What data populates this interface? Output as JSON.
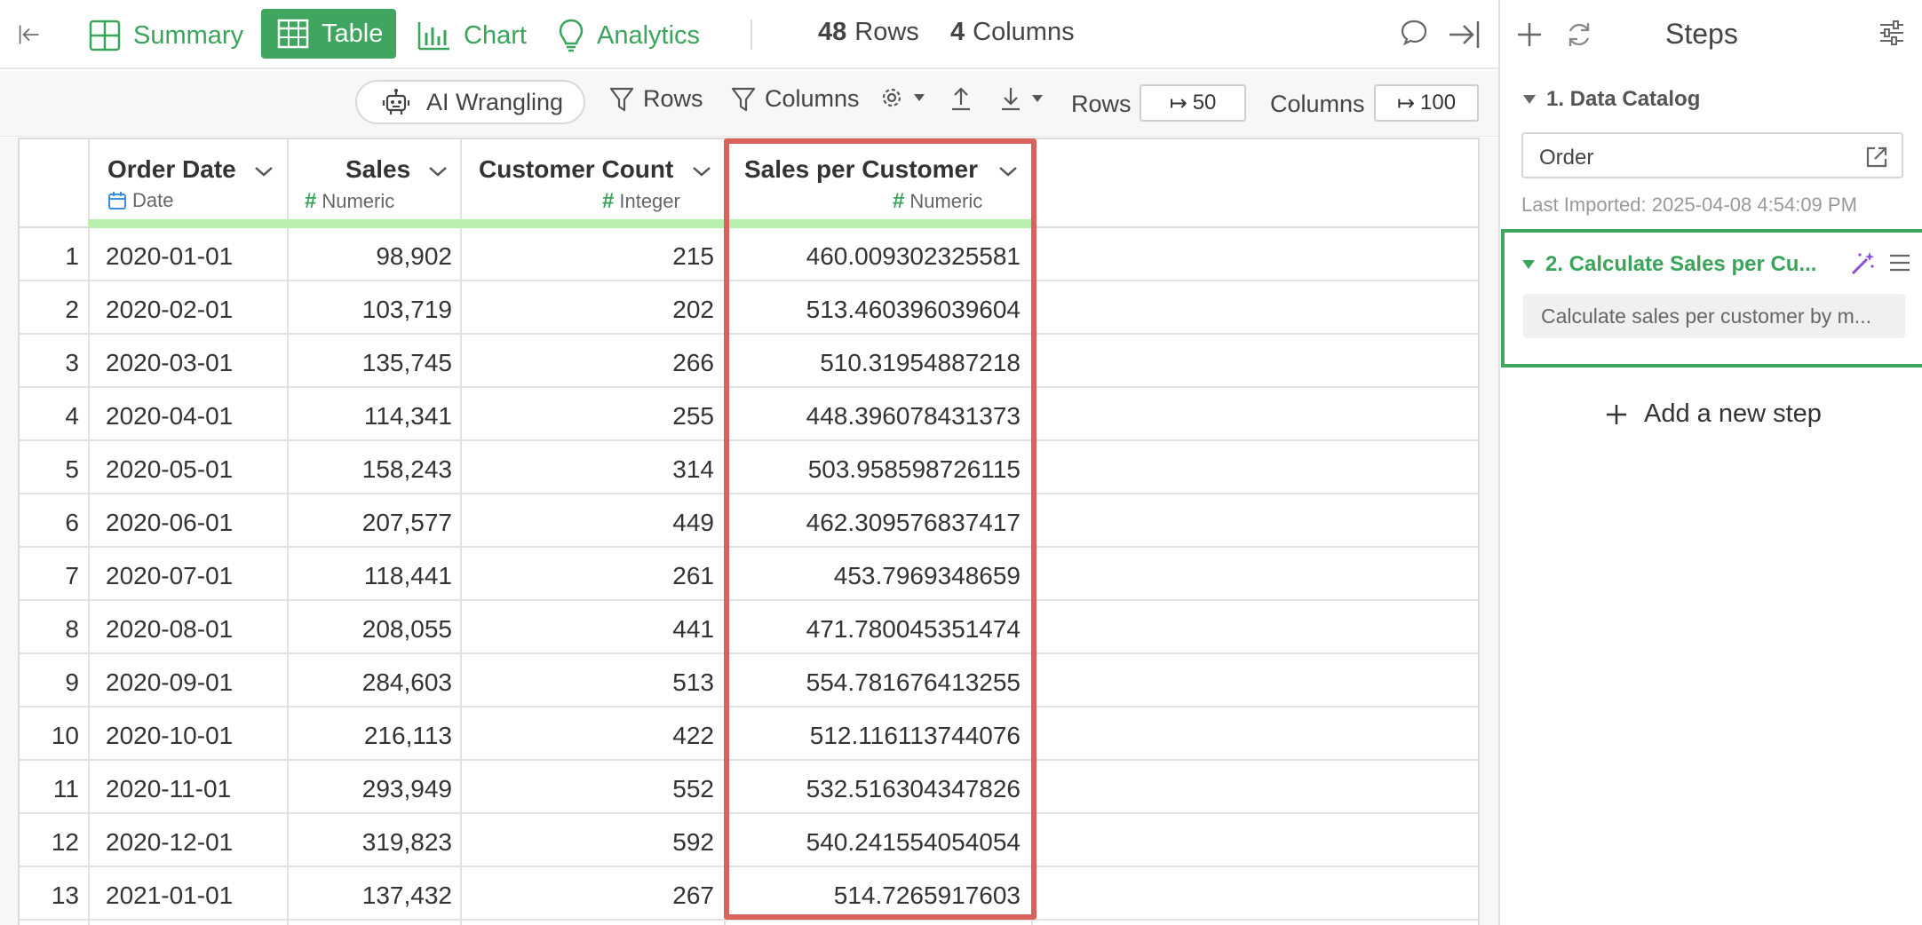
{
  "topbar": {
    "tabs": [
      {
        "label": "Summary",
        "icon": "summary-grid-icon"
      },
      {
        "label": "Table",
        "icon": "table-icon",
        "active": true
      },
      {
        "label": "Chart",
        "icon": "bar-chart-icon"
      },
      {
        "label": "Analytics",
        "icon": "lightbulb-icon"
      }
    ],
    "row_count": "48",
    "row_label": "Rows",
    "col_count": "4",
    "col_label": "Columns"
  },
  "toolbar": {
    "ai_label": "AI Wrangling",
    "rows_filter": "Rows",
    "columns_filter": "Columns",
    "rows_label": "Rows",
    "rows_value": "50",
    "columns_label": "Columns",
    "columns_value": "100"
  },
  "table": {
    "columns": [
      {
        "name": "Order Date",
        "type": "Date"
      },
      {
        "name": "Sales",
        "type": "Numeric"
      },
      {
        "name": "Customer Count",
        "type": "Integer"
      },
      {
        "name": "Sales per Customer",
        "type": "Numeric"
      }
    ],
    "rows": [
      {
        "n": "1",
        "date": "2020-01-01",
        "sales": "98,902",
        "count": "215",
        "spc": "460.009302325581"
      },
      {
        "n": "2",
        "date": "2020-02-01",
        "sales": "103,719",
        "count": "202",
        "spc": "513.460396039604"
      },
      {
        "n": "3",
        "date": "2020-03-01",
        "sales": "135,745",
        "count": "266",
        "spc": "510.31954887218"
      },
      {
        "n": "4",
        "date": "2020-04-01",
        "sales": "114,341",
        "count": "255",
        "spc": "448.396078431373"
      },
      {
        "n": "5",
        "date": "2020-05-01",
        "sales": "158,243",
        "count": "314",
        "spc": "503.958598726115"
      },
      {
        "n": "6",
        "date": "2020-06-01",
        "sales": "207,577",
        "count": "449",
        "spc": "462.309576837417"
      },
      {
        "n": "7",
        "date": "2020-07-01",
        "sales": "118,441",
        "count": "261",
        "spc": "453.7969348659"
      },
      {
        "n": "8",
        "date": "2020-08-01",
        "sales": "208,055",
        "count": "441",
        "spc": "471.780045351474"
      },
      {
        "n": "9",
        "date": "2020-09-01",
        "sales": "284,603",
        "count": "513",
        "spc": "554.781676413255"
      },
      {
        "n": "10",
        "date": "2020-10-01",
        "sales": "216,113",
        "count": "422",
        "spc": "512.116113744076"
      },
      {
        "n": "11",
        "date": "2020-11-01",
        "sales": "293,949",
        "count": "552",
        "spc": "532.516304347826"
      },
      {
        "n": "12",
        "date": "2020-12-01",
        "sales": "319,823",
        "count": "592",
        "spc": "540.241554054054"
      },
      {
        "n": "13",
        "date": "2021-01-01",
        "sales": "137,432",
        "count": "267",
        "spc": "514.7265917603"
      }
    ]
  },
  "panel": {
    "title": "Steps",
    "step1_title": "1. Data Catalog",
    "catalog_name": "Order",
    "last_imported": "Last Imported: 2025-04-08 4:54:09 PM",
    "step2_title": "2. Calculate Sales per Cu...",
    "step2_desc": "Calculate sales per customer by m...",
    "add_step": "Add a new step"
  },
  "colors": {
    "accent_green": "#3fa55f",
    "highlight_red": "#d9625a",
    "header_bar": "#b9efad",
    "wand_purple": "#8a4fd8"
  }
}
